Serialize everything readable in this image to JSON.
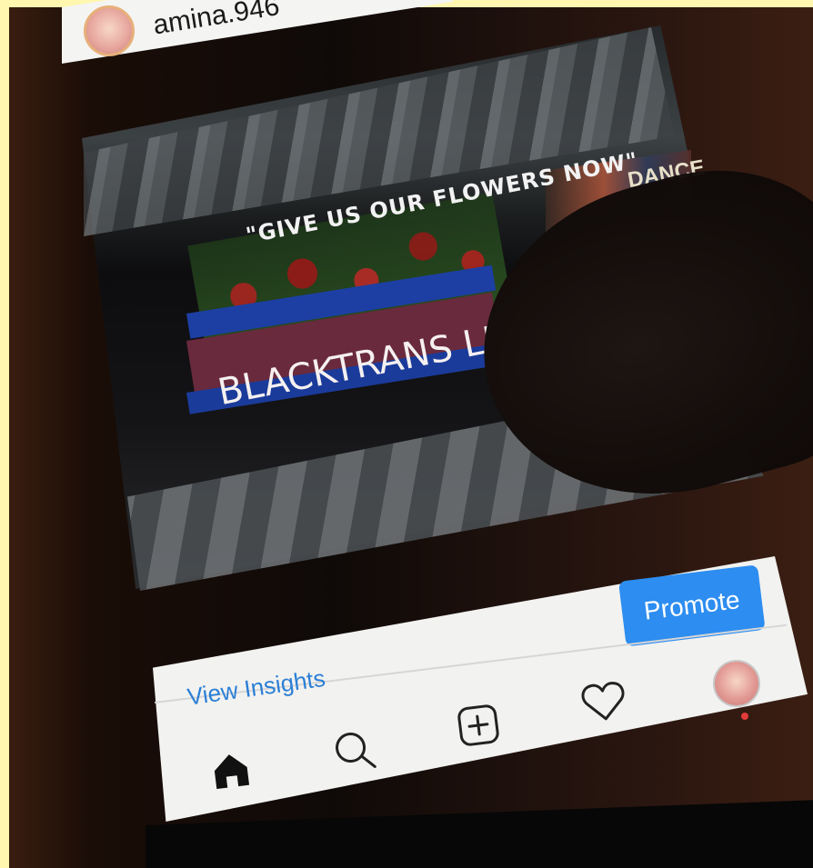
{
  "profile": {
    "username": "amina.946"
  },
  "post": {
    "mural_headline": "\"GIVE US OUR FLOWERS NOW\"",
    "mural_slogan": "BLACKTRANS LIVESMATT",
    "mural_side_text": "DANCE"
  },
  "actions": {
    "promote_label": "Promote",
    "view_insights_label": "View Insights"
  },
  "nav": {
    "items": [
      {
        "name": "home",
        "icon": "home-icon"
      },
      {
        "name": "search",
        "icon": "search-icon"
      },
      {
        "name": "new-post",
        "icon": "plus-square-icon"
      },
      {
        "name": "activity",
        "icon": "heart-icon"
      },
      {
        "name": "profile",
        "icon": "avatar"
      }
    ],
    "notification_color": "#e33b3b"
  },
  "colors": {
    "accent": "#2d8df0",
    "link": "#2b7fd6",
    "surface": "#f2f2f0"
  }
}
